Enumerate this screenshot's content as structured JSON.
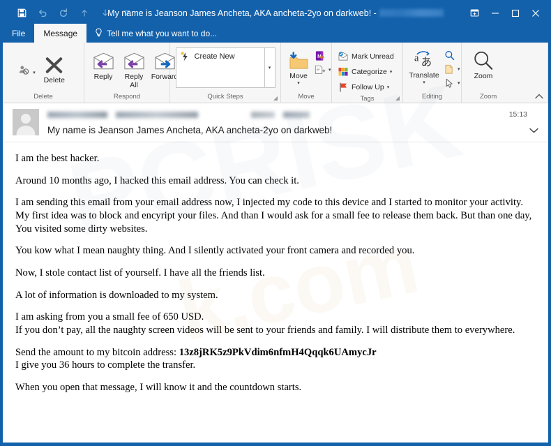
{
  "window": {
    "title": "My name is Jeanson James Ancheta, AKA ancheta-2yo on darkweb! -",
    "title_redacted_suffix": true,
    "accent_color": "#1361ab",
    "ribbon_bg": "#f6f6f6"
  },
  "quick_access": [
    {
      "name": "save",
      "glyph": "💾",
      "label": "Save",
      "enabled": true
    },
    {
      "name": "undo",
      "glyph": "↶",
      "label": "Undo",
      "enabled": false
    },
    {
      "name": "redo",
      "glyph": "↻",
      "label": "Redo",
      "enabled": false
    },
    {
      "name": "previous-item",
      "glyph": "↑",
      "label": "Previous Item",
      "enabled": false
    },
    {
      "name": "next-item",
      "glyph": "↓",
      "label": "Next Item",
      "enabled": false
    },
    {
      "name": "customize-quick-access-toolbar",
      "glyph": "▾",
      "label": "Customize Quick Access Toolbar",
      "enabled": false
    }
  ],
  "window_controls": [
    {
      "name": "ribbon-display-options",
      "label": "Ribbon Display Options"
    },
    {
      "name": "minimize",
      "label": "Minimize"
    },
    {
      "name": "maximize",
      "label": "Maximize"
    },
    {
      "name": "close",
      "label": "Close"
    }
  ],
  "tabs": [
    {
      "label": "File",
      "active": false
    },
    {
      "label": "Message",
      "active": true
    }
  ],
  "tell_me": {
    "label": "Tell me what you want to do...",
    "icon": "lightbulb-icon"
  },
  "ribbon": {
    "collapse_label": "˄",
    "groups": [
      {
        "label": "Delete",
        "small_buttons": [
          {
            "label": "",
            "icon": "ignore-icon",
            "has_caret": true
          }
        ],
        "big_buttons": [
          {
            "label": "Delete",
            "icon": "delete-x-icon",
            "has_caret": false
          }
        ]
      },
      {
        "label": "Respond",
        "big_buttons": [
          {
            "label": "Reply",
            "icon": "reply-icon"
          },
          {
            "label": "Reply\nAll",
            "icon": "reply-all-icon"
          },
          {
            "label": "Forward",
            "icon": "forward-icon"
          }
        ],
        "small_buttons": [
          {
            "label": "",
            "icon": "meeting-icon",
            "has_caret": false
          },
          {
            "label": "",
            "icon": "more-respond-icon",
            "has_caret": true
          }
        ]
      },
      {
        "label": "Quick Steps",
        "has_dialog_launcher": true,
        "gallery_item": {
          "label": "Create New",
          "icon": "quick-step-bolt-icon"
        }
      },
      {
        "label": "Move",
        "big_buttons": [
          {
            "label": "Move",
            "icon": "move-folder-icon",
            "has_caret": true
          }
        ],
        "small_buttons": [
          {
            "label": "",
            "icon": "onenote-icon",
            "has_caret": false
          },
          {
            "label": "",
            "icon": "rules-icon",
            "has_caret": true
          }
        ]
      },
      {
        "label": "Tags",
        "has_dialog_launcher": true,
        "small_buttons": [
          {
            "label": "Mark Unread",
            "icon": "mark-unread-icon",
            "has_caret": false
          },
          {
            "label": "Categorize",
            "icon": "categorize-icon",
            "has_caret": true
          },
          {
            "label": "Follow Up",
            "icon": "follow-up-flag-icon",
            "has_caret": true
          }
        ]
      },
      {
        "label": "Editing",
        "big_buttons": [
          {
            "label": "Translate",
            "icon": "translate-icon",
            "has_caret": true
          }
        ],
        "small_buttons": [
          {
            "label": "",
            "icon": "find-icon",
            "has_caret": false
          },
          {
            "label": "",
            "icon": "related-icon",
            "has_caret": true
          },
          {
            "label": "",
            "icon": "select-pointer-icon",
            "has_caret": true
          }
        ]
      },
      {
        "label": "Zoom",
        "big_buttons": [
          {
            "label": "Zoom",
            "icon": "zoom-magnifier-icon",
            "has_caret": false
          }
        ]
      }
    ]
  },
  "message": {
    "avatar": "contact-avatar",
    "sender_redacted": true,
    "subject": "My name is Jeanson James Ancheta, AKA ancheta-2yo on darkweb!",
    "time": "15:13",
    "expand_icon": "chevron-down-icon",
    "body": [
      {
        "text": "I am the best hacker.",
        "bold_tail": ""
      },
      {
        "text": "Around 10 months ago, I hacked this email address. You can check it."
      },
      {
        "text": "I am sending this email from your email address now, I injected my code to this device and I started to monitor your activity. My first idea was to block and encyript your files. And than I would ask for a small fee to release them back. But than one day, You visited some dirty websites."
      },
      {
        "text": "You kow what I mean naughty thing. And I silently activated your front camera and recorded you."
      },
      {
        "text": "Now, I stole contact list of yourself. I have all the friends list."
      },
      {
        "text": "A lot of information is downloaded to my system."
      },
      {
        "text": "I am asking from you a small fee of 650 USD."
      },
      {
        "text": "If you don’t pay, all the naughty screen videos will be sent to your friends and family. I will distribute them to everywhere."
      },
      {
        "text": "Send the amount to my bitcoin address: ",
        "bold_tail": "13z8jRK5z9PkVdim6nfmH4Qqqk6UAmycJr"
      },
      {
        "text": "I give you 36 hours to complete the transfer."
      },
      {
        "text": "When you open that message, I will know it and the countdown starts."
      }
    ]
  },
  "watermark": {
    "line1": "PCRISK",
    "line2": "k.com"
  }
}
